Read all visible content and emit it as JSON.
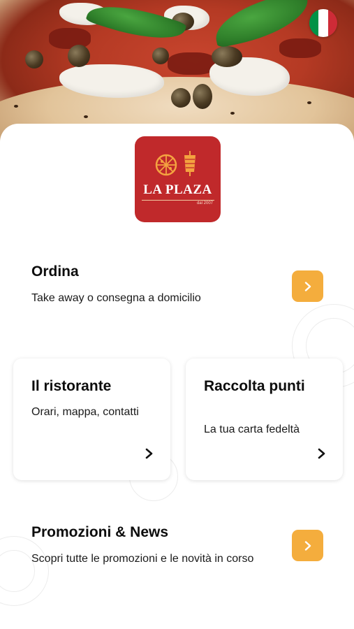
{
  "hero": {
    "flag": {
      "icon": "italy-flag-icon",
      "colors": [
        "#009246",
        "#ffffff",
        "#ce2b37"
      ]
    }
  },
  "logo": {
    "name": "LA PLAZA",
    "since": "dal 2007",
    "icons": [
      "pizza-icon",
      "kebab-icon"
    ],
    "color": "#c0292b"
  },
  "ordina": {
    "title": "Ordina",
    "subtitle": "Take away o consegna a domicilio",
    "icon": "chevron-right-icon"
  },
  "cards": [
    {
      "title": "Il ristorante",
      "subtitle": "Orari, mappa, contatti",
      "icon": "chevron-right-icon"
    },
    {
      "title": "Raccolta punti",
      "subtitle": "La tua carta fedeltà",
      "icon": "chevron-right-icon"
    }
  ],
  "promo": {
    "title": "Promozioni & News",
    "subtitle": "Scopri tutte le promozioni e le novità in corso",
    "icon": "chevron-right-icon"
  },
  "theme": {
    "accent": "#f4ad3d"
  }
}
